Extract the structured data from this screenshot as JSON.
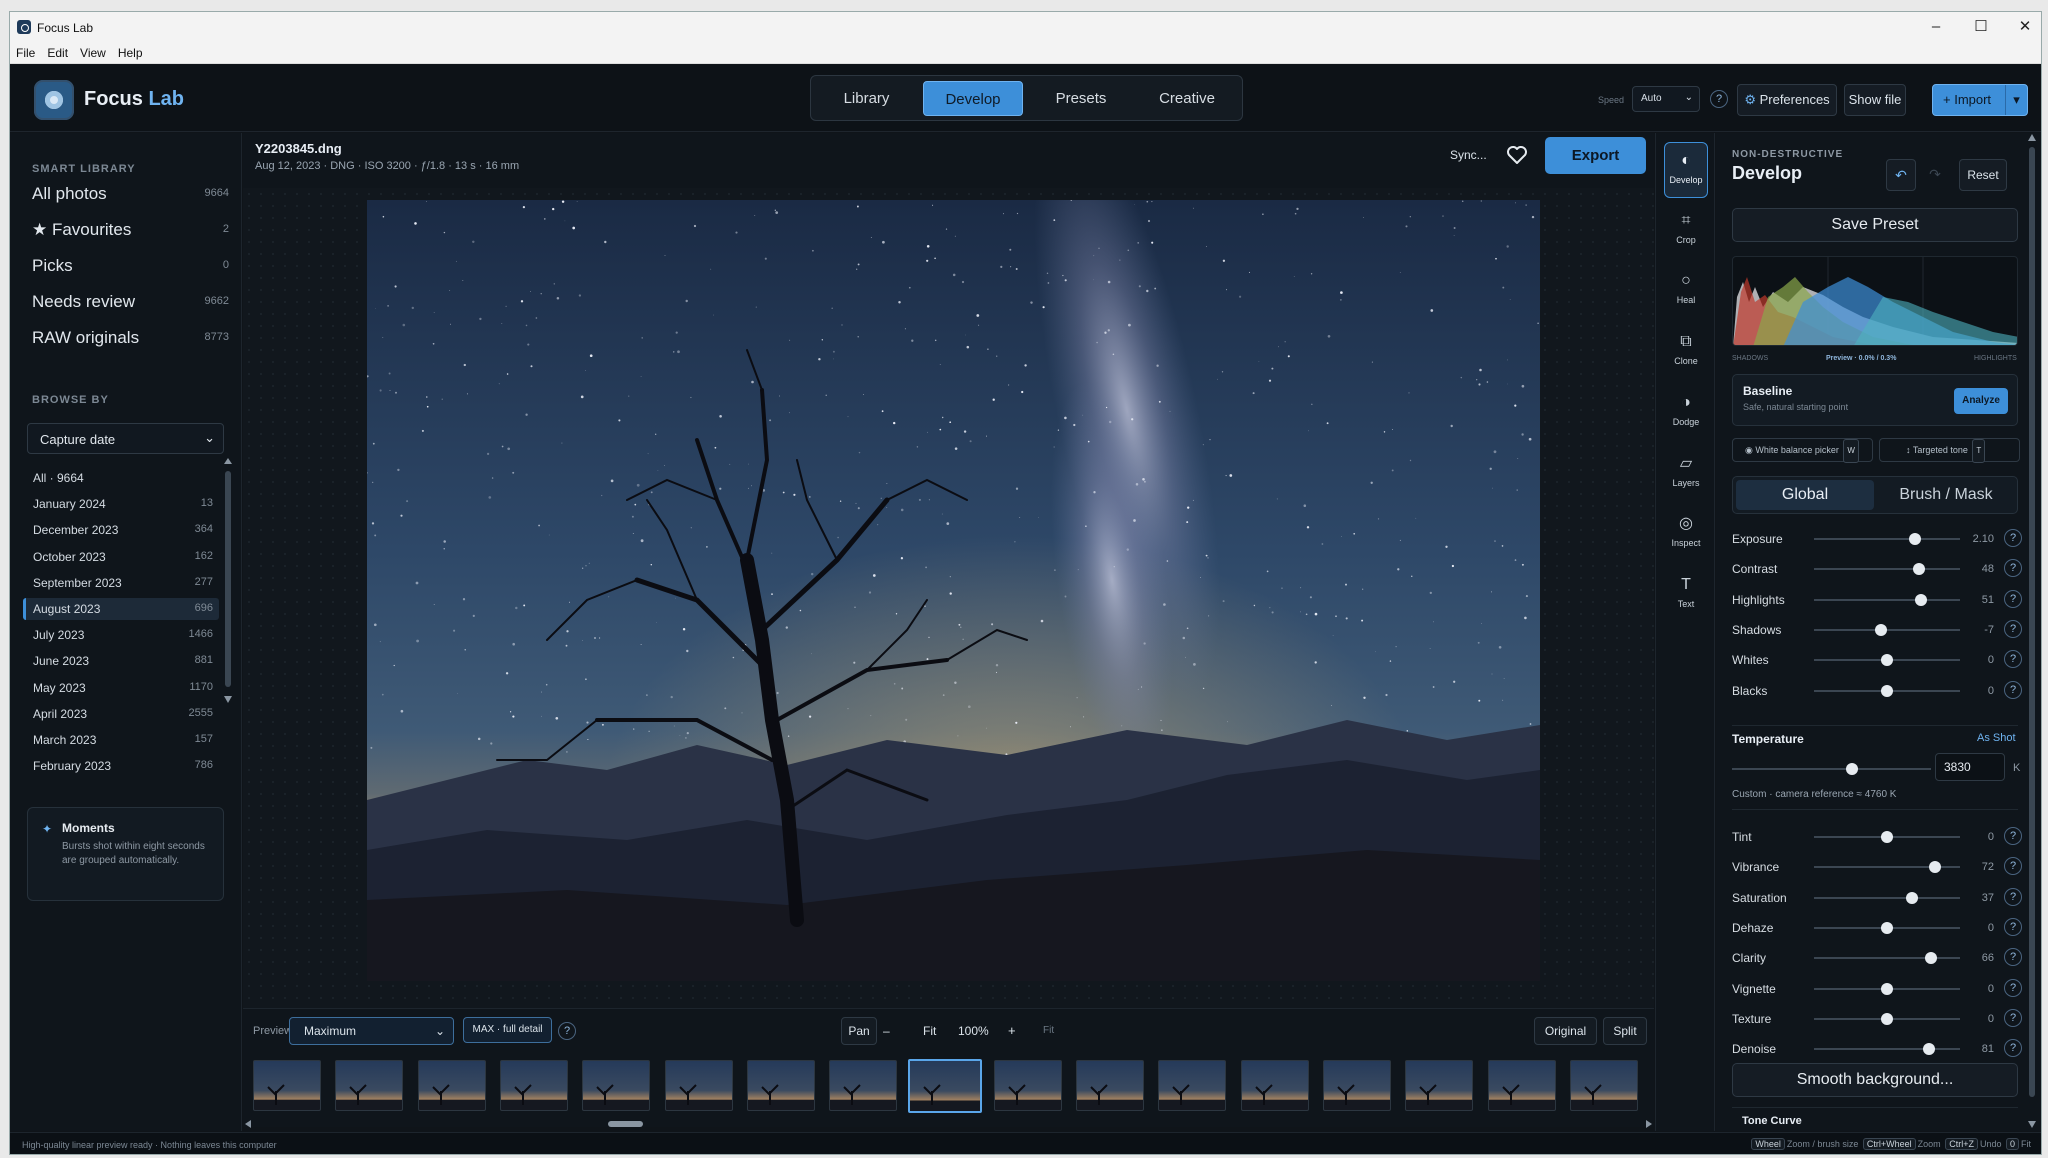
{
  "window": {
    "title": "Focus Lab"
  },
  "menu": [
    "File",
    "Edit",
    "View",
    "Help"
  ],
  "header": {
    "brand_main": "Focus",
    "brand_accent": "Lab",
    "tabs": [
      "Library",
      "Develop",
      "Presets",
      "Creative"
    ],
    "active_tab": "Develop",
    "speed_label": "Speed",
    "speed_value": "Auto",
    "preferences": "Preferences",
    "show_file": "Show file",
    "import": "+ Import"
  },
  "sidebar": {
    "smart_label": "SMART LIBRARY",
    "library": [
      {
        "label": "All photos",
        "count": "9664"
      },
      {
        "label": "★ Favourites",
        "count": "2"
      },
      {
        "label": "Picks",
        "count": "0"
      },
      {
        "label": "Needs review",
        "count": "9662"
      },
      {
        "label": "RAW originals",
        "count": "8773"
      }
    ],
    "browse_label": "BROWSE BY",
    "browse_value": "Capture date",
    "months": [
      {
        "label": "All · 9664",
        "count": ""
      },
      {
        "label": "January 2024",
        "count": "13"
      },
      {
        "label": "December 2023",
        "count": "364"
      },
      {
        "label": "October 2023",
        "count": "162"
      },
      {
        "label": "September 2023",
        "count": "277"
      },
      {
        "label": "August 2023",
        "count": "696"
      },
      {
        "label": "July 2023",
        "count": "1466"
      },
      {
        "label": "June 2023",
        "count": "881"
      },
      {
        "label": "May 2023",
        "count": "1170"
      },
      {
        "label": "April 2023",
        "count": "2555"
      },
      {
        "label": "March 2023",
        "count": "157"
      },
      {
        "label": "February 2023",
        "count": "786"
      }
    ],
    "selected_month": "August 2023",
    "moments": {
      "title": "Moments",
      "text": "Bursts shot within eight seconds are grouped automatically."
    }
  },
  "photo": {
    "filename": "Y2203845.dng",
    "meta": "Aug 12, 2023 · DNG · ISO 3200 · ƒ/1.8 · 13 s · 16 mm",
    "sync": "Sync...",
    "export": "Export"
  },
  "bottom": {
    "preview_label": "Preview",
    "preview_value": "Maximum",
    "max_badge": "MAX · full detail",
    "pan": "Pan",
    "minus": "–",
    "fit": "Fit",
    "zoom": "100%",
    "plus": "+",
    "fit2": "Fit",
    "original": "Original",
    "split": "Split"
  },
  "tools": [
    {
      "label": "Develop",
      "icon": "◐"
    },
    {
      "label": "Crop",
      "icon": "⌗"
    },
    {
      "label": "Heal",
      "icon": "○"
    },
    {
      "label": "Clone",
      "icon": "⧉"
    },
    {
      "label": "Dodge",
      "icon": "◑"
    },
    {
      "label": "Layers",
      "icon": "▱"
    },
    {
      "label": "Inspect",
      "icon": "◎"
    },
    {
      "label": "Text",
      "icon": "T"
    }
  ],
  "panel": {
    "kicker": "NON-DESTRUCTIVE",
    "title": "Develop",
    "reset": "Reset",
    "save_preset": "Save Preset",
    "hist_shadows": "SHADOWS",
    "hist_preview": "Preview · 0.0% / 0.3%",
    "hist_highlights": "HIGHLIGHTS",
    "baseline_title": "Baseline",
    "baseline_sub": "Safe, natural starting point",
    "analyze": "Analyze",
    "wb_picker": "White balance picker",
    "wb_key": "W",
    "targeted": "Targeted tone",
    "targeted_key": "T",
    "mode_global": "Global",
    "mode_brush": "Brush / Mask",
    "sliders_a": [
      {
        "label": "Exposure",
        "value": "2.10",
        "pos": 0.69
      },
      {
        "label": "Contrast",
        "value": "48",
        "pos": 0.72
      },
      {
        "label": "Highlights",
        "value": "51",
        "pos": 0.73
      },
      {
        "label": "Shadows",
        "value": "-7",
        "pos": 0.46
      },
      {
        "label": "Whites",
        "value": "0",
        "pos": 0.5
      },
      {
        "label": "Blacks",
        "value": "0",
        "pos": 0.5
      }
    ],
    "temp_label": "Temperature",
    "temp_asshot": "As Shot",
    "temp_value": "3830",
    "temp_unit": "K",
    "temp_note": "Custom · camera reference ≈ 4760 K",
    "sliders_b": [
      {
        "label": "Tint",
        "value": "0",
        "pos": 0.5
      },
      {
        "label": "Vibrance",
        "value": "72",
        "pos": 0.83
      },
      {
        "label": "Saturation",
        "value": "37",
        "pos": 0.67
      },
      {
        "label": "Dehaze",
        "value": "0",
        "pos": 0.5
      },
      {
        "label": "Clarity",
        "value": "66",
        "pos": 0.8
      },
      {
        "label": "Vignette",
        "value": "0",
        "pos": 0.5
      },
      {
        "label": "Texture",
        "value": "0",
        "pos": 0.5
      },
      {
        "label": "Denoise",
        "value": "81",
        "pos": 0.79
      }
    ],
    "smooth": "Smooth background...",
    "tone_curve": "Tone Curve"
  },
  "status": {
    "left": "High-quality linear preview ready · Nothing leaves this computer",
    "hints": [
      {
        "key": "Wheel",
        "text": "Zoom / brush size"
      },
      {
        "key": "Ctrl+Wheel",
        "text": "Zoom"
      },
      {
        "key": "Ctrl+Z",
        "text": "Undo"
      },
      {
        "key": "0",
        "text": "Fit"
      }
    ]
  },
  "colors": {
    "accent": "#3d8fd9",
    "bg": "#0f151b"
  }
}
